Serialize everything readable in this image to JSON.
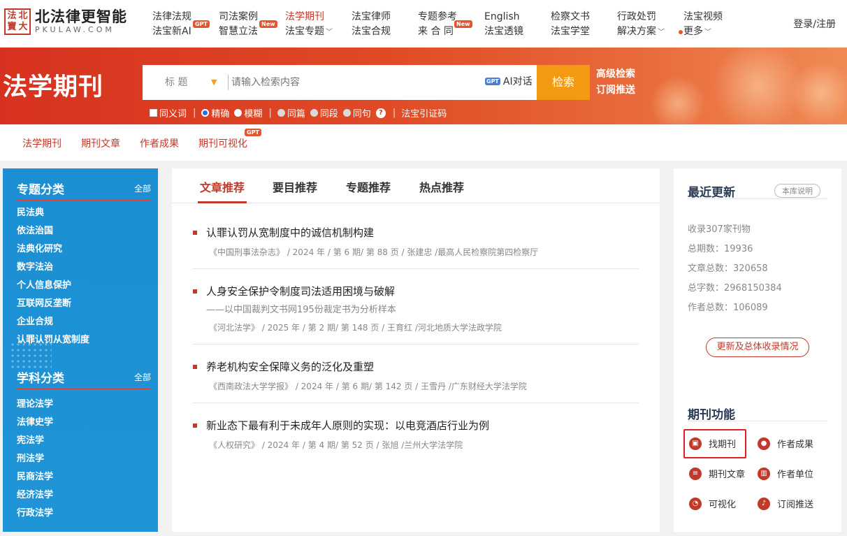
{
  "logo": {
    "seal_chars": [
      "法",
      "北",
      "寶",
      "大"
    ],
    "name": "北法律更智能",
    "domain": "PKULAW.COM"
  },
  "nav": {
    "columns": [
      {
        "top": "法律法规",
        "bottom": "法宝新AI",
        "badge_top": "",
        "badge_bottom": "GPT",
        "chev": false,
        "active": false
      },
      {
        "top": "司法案例",
        "bottom": "智慧立法",
        "badge_top": "",
        "badge_bottom": "New",
        "chev": false,
        "active": false
      },
      {
        "top": "法学期刊",
        "bottom": "法宝专题",
        "badge_top": "",
        "badge_bottom": "",
        "chev": true,
        "active": true
      },
      {
        "top": "法宝律师",
        "bottom": "法宝合规",
        "badge_top": "",
        "badge_bottom": "",
        "chev": false,
        "active": false
      },
      {
        "top": "专题参考",
        "bottom": "来 合 同",
        "badge_top": "",
        "badge_bottom": "New",
        "chev": false,
        "active": false
      },
      {
        "top": "English",
        "bottom": "法宝透镜",
        "badge_top": "",
        "badge_bottom": "",
        "chev": false,
        "active": false
      },
      {
        "top": "检察文书",
        "bottom": "法宝学堂",
        "badge_top": "",
        "badge_bottom": "",
        "chev": false,
        "active": false
      },
      {
        "top": "行政处罚",
        "bottom": "解决方案",
        "badge_top": "",
        "badge_bottom": "",
        "chev": true,
        "active": false
      },
      {
        "top": "法宝视频",
        "bottom": "更多",
        "badge_top": "",
        "badge_bottom": "",
        "chev": true,
        "active": false
      }
    ],
    "login": "登录/注册"
  },
  "banner": {
    "title": "法学期刊",
    "search_type": "标 题",
    "search_placeholder": "请输入检索内容",
    "ai_badge": "GPT",
    "ai_label": "AI对话",
    "search_button": "检索",
    "advanced": "高级检索",
    "subscribe": "订阅推送",
    "options": {
      "synonym": "同义词",
      "exact": "精确",
      "fuzzy": "模糊",
      "same_article": "同篇",
      "same_paragraph": "同段",
      "same_sentence": "同句",
      "help": "?",
      "cite": "法宝引证码"
    }
  },
  "subtabs": [
    "法学期刊",
    "期刊文章",
    "作者成果",
    "期刊可视化"
  ],
  "subtab_badge": "GPT",
  "sidebar": {
    "topic": {
      "title": "专题分类",
      "all": "全部",
      "items": [
        "民法典",
        "依法治国",
        "法典化研究",
        "数字法治",
        "个人信息保护",
        "互联网反垄断",
        "企业合规",
        "认罪认罚从宽制度"
      ]
    },
    "subject": {
      "title": "学科分类",
      "all": "全部",
      "items": [
        "理论法学",
        "法律史学",
        "宪法学",
        "刑法学",
        "民商法学",
        "经济法学",
        "行政法学"
      ]
    }
  },
  "center": {
    "tabs": [
      "文章推荐",
      "要目推荐",
      "专题推荐",
      "热点推荐"
    ],
    "articles": [
      {
        "title": "认罪认罚从宽制度中的诚信机制构建",
        "subtitle": "",
        "meta": "《中国刑事法杂志》 / 2024 年 / 第 6 期/ 第 88 页 / 张建忠 /最高人民检察院第四检察厅"
      },
      {
        "title": "人身安全保护令制度司法适用困境与破解",
        "subtitle": "——以中国裁判文书网195份裁定书为分析样本",
        "meta": "《河北法学》 / 2025 年 / 第 2 期/ 第 148 页 / 王育红 /河北地质大学法政学院"
      },
      {
        "title": "养老机构安全保障义务的泛化及重塑",
        "subtitle": "",
        "meta": "《西南政法大学学报》 / 2024 年 / 第 6 期/ 第 142 页 / 王雪丹 /广东财经大学法学院"
      },
      {
        "title": "新业态下最有利于未成年人原则的实现：以电竞酒店行业为例",
        "subtitle": "",
        "meta": "《人权研究》 / 2024 年 / 第 4 期/ 第 52 页 / 张旭 /兰州大学法学院"
      }
    ]
  },
  "right": {
    "recent_title": "最近更新",
    "library_note": "本库说明",
    "stats": [
      "收录307家刊物",
      "总期数：19936",
      "文章总数：320658",
      "总字数：2968150384",
      "作者总数：106089"
    ],
    "update_button": "更新及总体收录情况",
    "func_title": "期刊功能",
    "functions": [
      "找期刊",
      "作者成果",
      "期刊文章",
      "作者单位",
      "可视化",
      "订阅推送"
    ]
  },
  "colors": {
    "brand_red": "#c0392b",
    "search_orange": "#f39a12",
    "sidebar_blue": "#1f94d6"
  }
}
